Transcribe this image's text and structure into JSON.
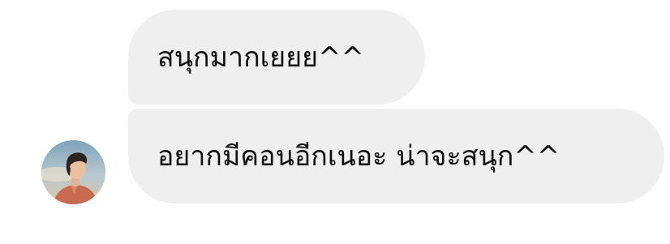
{
  "conversation": {
    "messages": [
      {
        "text": "สนุกมากเยยย^^"
      },
      {
        "text": "อยากมีคอนอีกเนอะ น่าจะสนุก^^"
      }
    ],
    "sender": {
      "avatar_icon": "person-photo-avatar"
    }
  },
  "colors": {
    "bubble_background": "#efefef",
    "message_text": "#0f0f0f",
    "page_background": "#ffffff"
  }
}
